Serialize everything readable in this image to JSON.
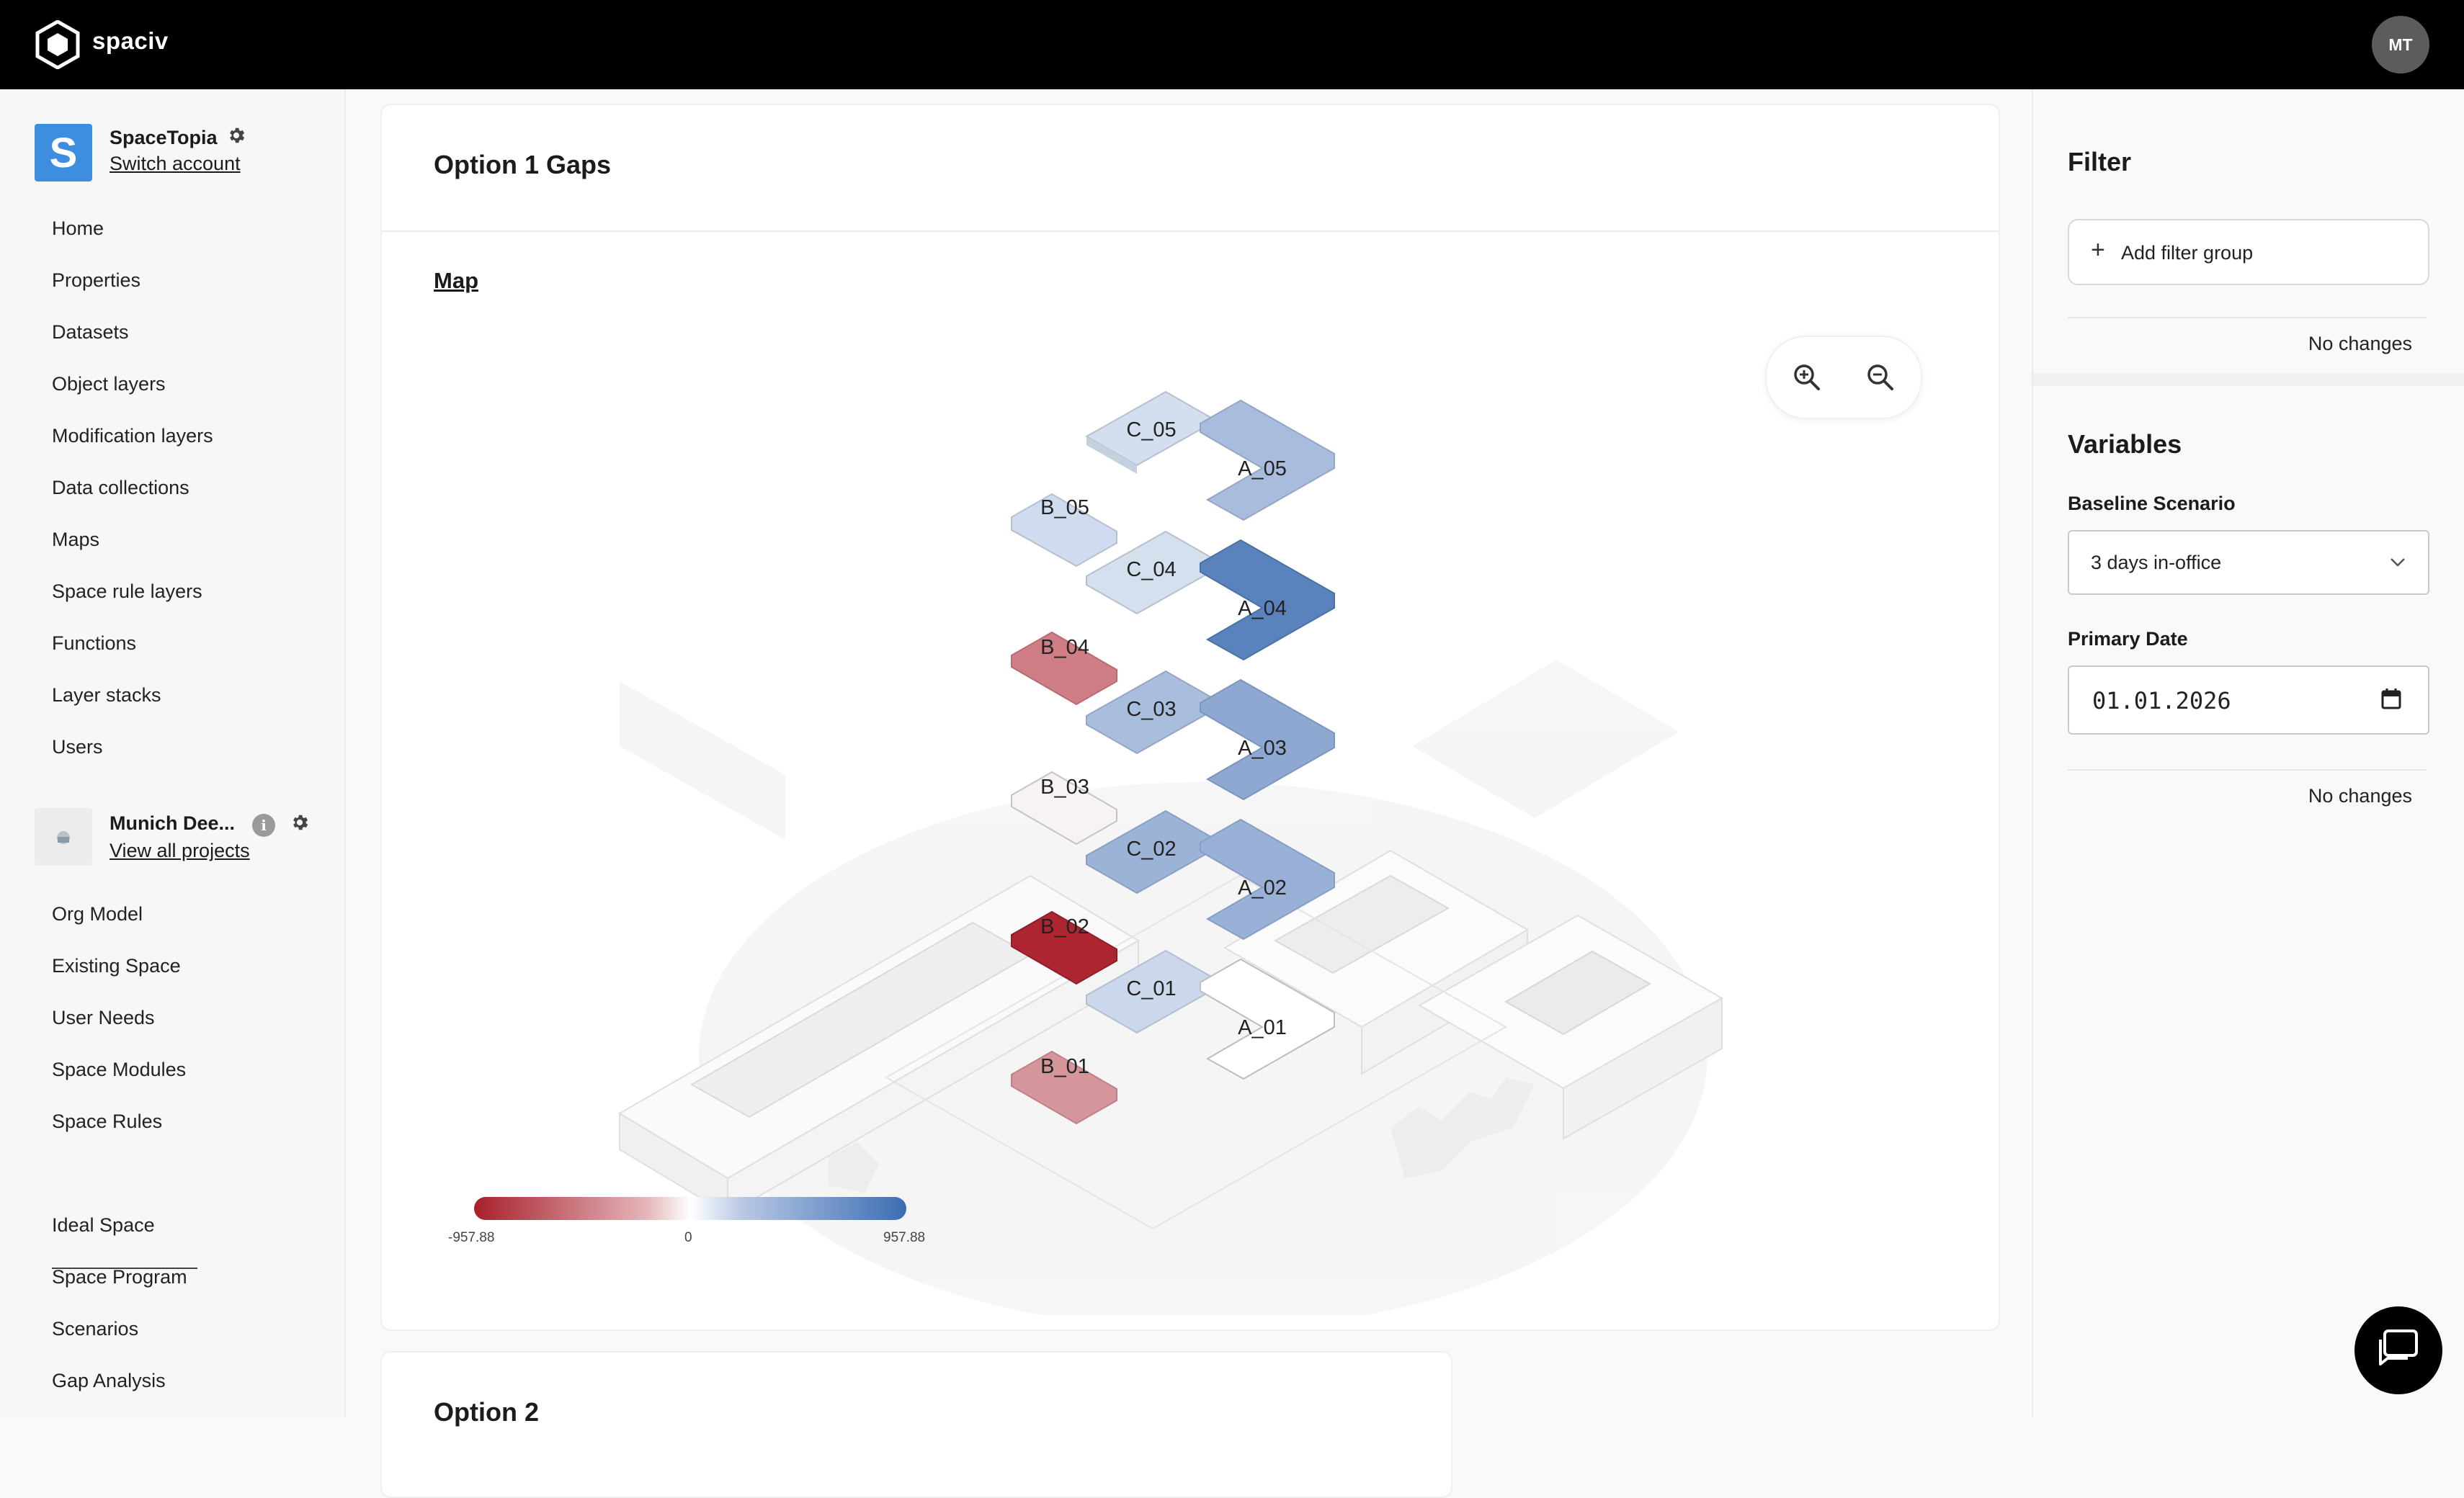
{
  "app": {
    "brand": "spaciv",
    "user_initials": "MT"
  },
  "account": {
    "name": "SpaceTopia",
    "logo_letter": "S",
    "switch_label": "Switch account"
  },
  "nav_primary": [
    "Home",
    "Properties",
    "Datasets",
    "Object layers",
    "Modification layers",
    "Data collections",
    "Maps",
    "Space rule layers",
    "Functions",
    "Layer stacks",
    "Users"
  ],
  "project": {
    "name": "Munich Dee...",
    "info_glyph": "i",
    "link_label": "View all projects"
  },
  "nav_project": [
    "Org Model",
    "Existing Space",
    "User Needs",
    "Space Modules",
    "Space Rules"
  ],
  "nav_secondary": [
    "Ideal Space",
    "Space Program",
    "Scenarios",
    "Gap Analysis"
  ],
  "main": {
    "title": "Option 1 Gaps",
    "map_label": "Map",
    "next_card_title": "Option 2"
  },
  "map": {
    "zones": [
      {
        "label": "C_05",
        "color": "#d3deee"
      },
      {
        "label": "A_05",
        "color": "#a9bcdd"
      },
      {
        "label": "B_05",
        "color": "#cfdbee"
      },
      {
        "label": "C_04",
        "color": "#d5e0ef"
      },
      {
        "label": "A_04",
        "color": "#5a83bd"
      },
      {
        "label": "B_04",
        "color": "#cf7e86"
      },
      {
        "label": "C_03",
        "color": "#a9bedd"
      },
      {
        "label": "A_03",
        "color": "#8ea8d2"
      },
      {
        "label": "B_03",
        "color": "#f7f2f3"
      },
      {
        "label": "C_02",
        "color": "#9cb3d8"
      },
      {
        "label": "A_02",
        "color": "#9ab1d7"
      },
      {
        "label": "B_02",
        "color": "#ad2530"
      },
      {
        "label": "C_01",
        "color": "#cbd8ec"
      },
      {
        "label": "A_01",
        "color": "#ffffff"
      },
      {
        "label": "B_01",
        "color": "#d4959b"
      }
    ],
    "legend": {
      "min": "-957.88",
      "mid": "0",
      "max": "957.88",
      "color_low": "#a8202c",
      "color_mid": "#ffffff",
      "color_high": "#3b6db3"
    }
  },
  "filter": {
    "title": "Filter",
    "add_label": "Add filter group",
    "status": "No changes"
  },
  "variables": {
    "title": "Variables",
    "baseline_label": "Baseline Scenario",
    "baseline_value": "3 days in-office",
    "date_label": "Primary Date",
    "date_value": "01.01.2026",
    "status": "No changes"
  },
  "icons": [
    "logo-icon",
    "gear-icon",
    "info-icon",
    "zoom-in-icon",
    "zoom-out-icon",
    "plus-icon",
    "chevron-down-icon",
    "calendar-icon",
    "chat-icon"
  ]
}
